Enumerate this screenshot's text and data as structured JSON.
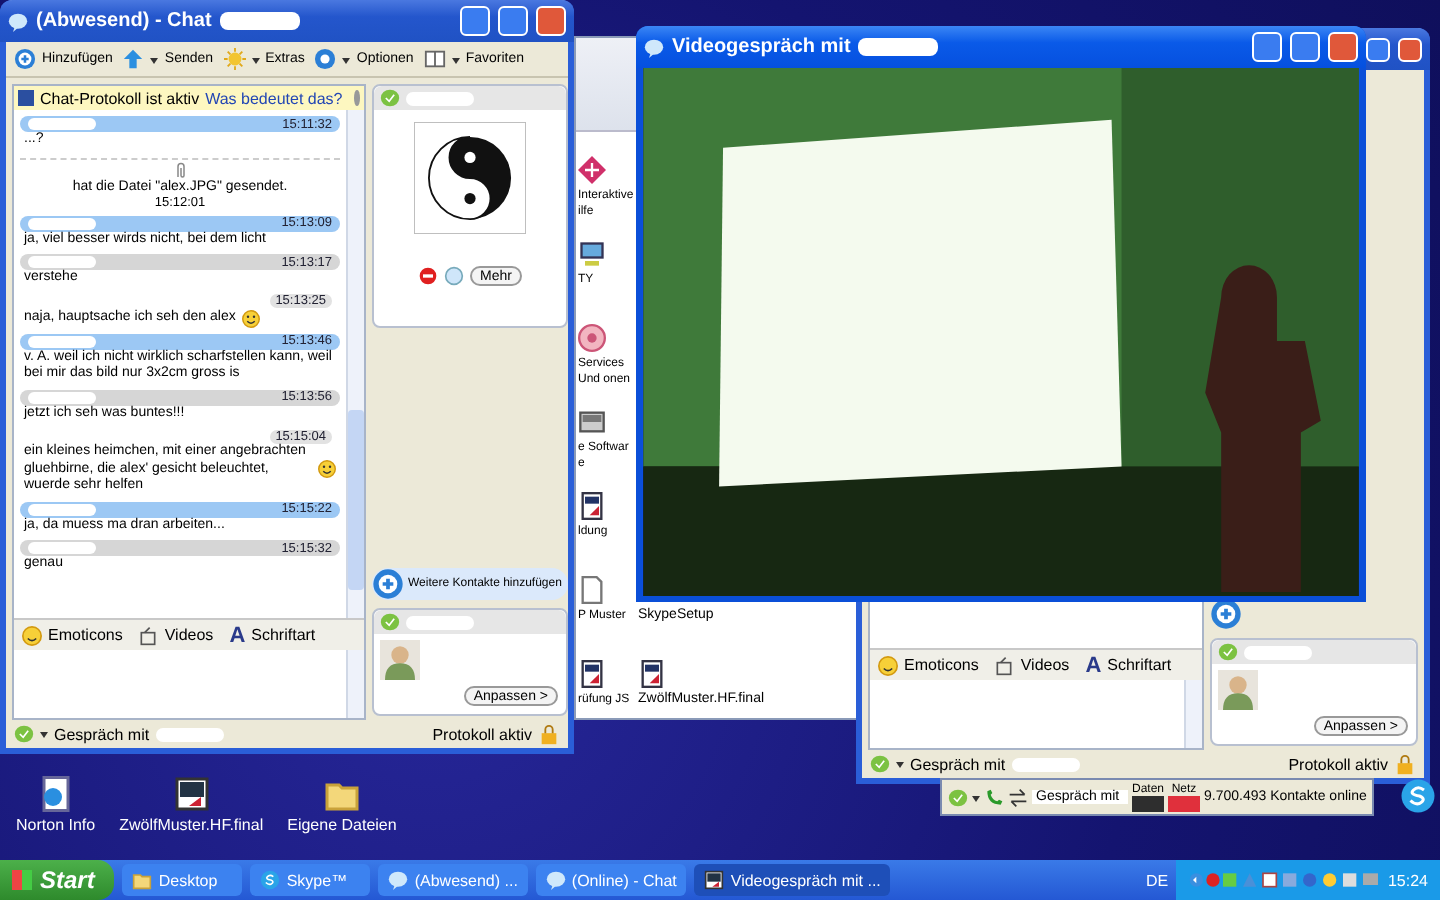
{
  "explorer_icons": [
    {
      "kind": "help",
      "label": "Interaktive ilfe"
    },
    {
      "kind": "computer",
      "label": "TY"
    },
    {
      "kind": "service",
      "label": "Services Und onen"
    },
    {
      "kind": "software",
      "label": "e Software"
    },
    {
      "kind": "document",
      "label": "ldung"
    },
    {
      "kind": "page",
      "label": "P Muster"
    },
    {
      "kind": "setup",
      "label": "SkypeSetup"
    },
    {
      "kind": "document",
      "label": "rüfung JS"
    },
    {
      "kind": "document",
      "label": "ZwölfMuster.HF.final"
    }
  ],
  "second_chat_window": {
    "format_bar": [
      {
        "kind": "emoticons",
        "label": "Emoticons"
      },
      {
        "kind": "videos",
        "label": "Videos"
      },
      {
        "kind": "font",
        "glyph": "A",
        "label": "Schriftart"
      }
    ],
    "customize": "Anpassen >",
    "status_bar": {
      "conversation": "Gespräch mit",
      "log": "Protokoll aktiv"
    }
  },
  "chat_window": {
    "title": "(Abwesend) - Chat",
    "toolbar": [
      {
        "kind": "add",
        "label": "Hinzufügen"
      },
      {
        "kind": "send",
        "label": "Senden"
      },
      {
        "kind": "extras",
        "label": "Extras"
      },
      {
        "kind": "options",
        "label": "Optionen"
      },
      {
        "kind": "favorites",
        "label": "Favoriten"
      }
    ],
    "info_bar": {
      "text": "Chat-Protokoll ist aktiv",
      "link": "Was bedeutet das?"
    },
    "messages": [
      {
        "kind": "own",
        "time": "15:11:32",
        "text": "...?"
      },
      {
        "kind": "file",
        "time": "15:12:01",
        "text": "hat die Datei \"alex.JPG\" gesendet."
      },
      {
        "kind": "own",
        "time": "15:13:09",
        "text": "ja, viel besser wirds nicht, bei dem licht"
      },
      {
        "kind": "other",
        "time": "15:13:17",
        "text": "verstehe"
      },
      {
        "kind": "continued",
        "time": "15:13:25",
        "text": "naja, hauptsache ich seh den alex",
        "emoticon": true
      },
      {
        "kind": "own",
        "time": "15:13:46",
        "text": "v. A. weil ich nicht wirklich scharfstellen kann, weil bei mir das bild nur 3x2cm gross is"
      },
      {
        "kind": "other",
        "time": "15:13:56",
        "text": "jetzt ich seh was buntes!!!"
      },
      {
        "kind": "continued",
        "time": "15:15:04",
        "text": "ein kleines heimchen, mit einer angebrachten gluehbirne, die alex' gesicht beleuchtet, wuerde sehr helfen",
        "emoticon": true
      },
      {
        "kind": "own",
        "time": "15:15:22",
        "text": "ja, da muess ma dran arbeiten..."
      },
      {
        "kind": "other",
        "time": "15:15:32",
        "text": "genau"
      }
    ],
    "contact_button": "Mehr",
    "add_contacts": "Weitere Kontakte hinzufügen",
    "customize": "Anpassen >",
    "format_bar": [
      {
        "kind": "emoticons",
        "label": "Emoticons"
      },
      {
        "kind": "videos",
        "label": "Videos"
      },
      {
        "kind": "font",
        "glyph": "A",
        "label": "Schriftart"
      }
    ],
    "status_bar": {
      "conversation": "Gespräch mit",
      "log": "Protokoll aktiv"
    }
  },
  "video_window": {
    "title": "Videogespräch mit"
  },
  "skype_bar": {
    "conversation": "Gespräch mit",
    "meters": [
      {
        "label": "Daten",
        "color": "#2e2e2e"
      },
      {
        "label": "Netz",
        "color": "#e0303c"
      }
    ],
    "online": "9.700.493 Kontakte online"
  },
  "desktop_icons": [
    {
      "kind": "web",
      "label": "Norton Info"
    },
    {
      "kind": "video",
      "label": "ZwölfMuster.HF.final"
    },
    {
      "kind": "folder",
      "label": "Eigene Dateien"
    }
  ],
  "taskbar": {
    "start": "Start",
    "buttons": [
      {
        "kind": "folder",
        "label": "Desktop",
        "selected": false
      },
      {
        "kind": "skype",
        "label": "Skype™",
        "selected": false
      },
      {
        "kind": "chat",
        "label": "(Abwesend) ...",
        "selected": false
      },
      {
        "kind": "chat",
        "label": "(Online) - Chat",
        "selected": false
      },
      {
        "kind": "video",
        "label": "Videogespräch mit ...",
        "selected": true
      }
    ],
    "language": "DE",
    "clock": "15:24"
  }
}
